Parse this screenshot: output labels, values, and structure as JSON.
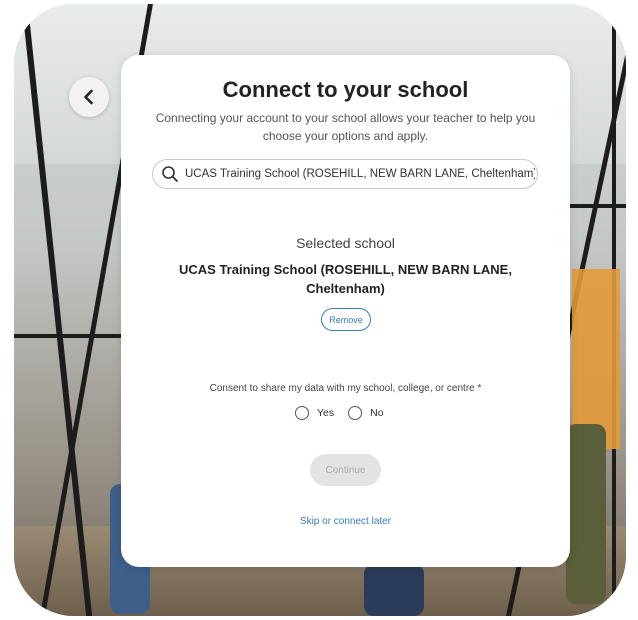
{
  "dialog": {
    "title": "Connect to your school",
    "subtitle": "Connecting your account to your school allows your teacher to help you choose your options and apply."
  },
  "search": {
    "value": "UCAS Training School (ROSEHILL, NEW BARN LANE, Cheltenham)",
    "icon": "search-icon"
  },
  "selected": {
    "label": "Selected school",
    "name": "UCAS Training School (ROSEHILL, NEW BARN LANE, Cheltenham)",
    "remove_label": "Remove"
  },
  "consent": {
    "question": "Consent to share my data with my school, college, or centre *",
    "options": [
      "Yes",
      "No"
    ]
  },
  "actions": {
    "continue_label": "Continue",
    "skip_label": "Skip or connect later"
  },
  "colors": {
    "link": "#3b7bbf",
    "title": "#222222",
    "disabled_button": "#e3e3e3"
  }
}
